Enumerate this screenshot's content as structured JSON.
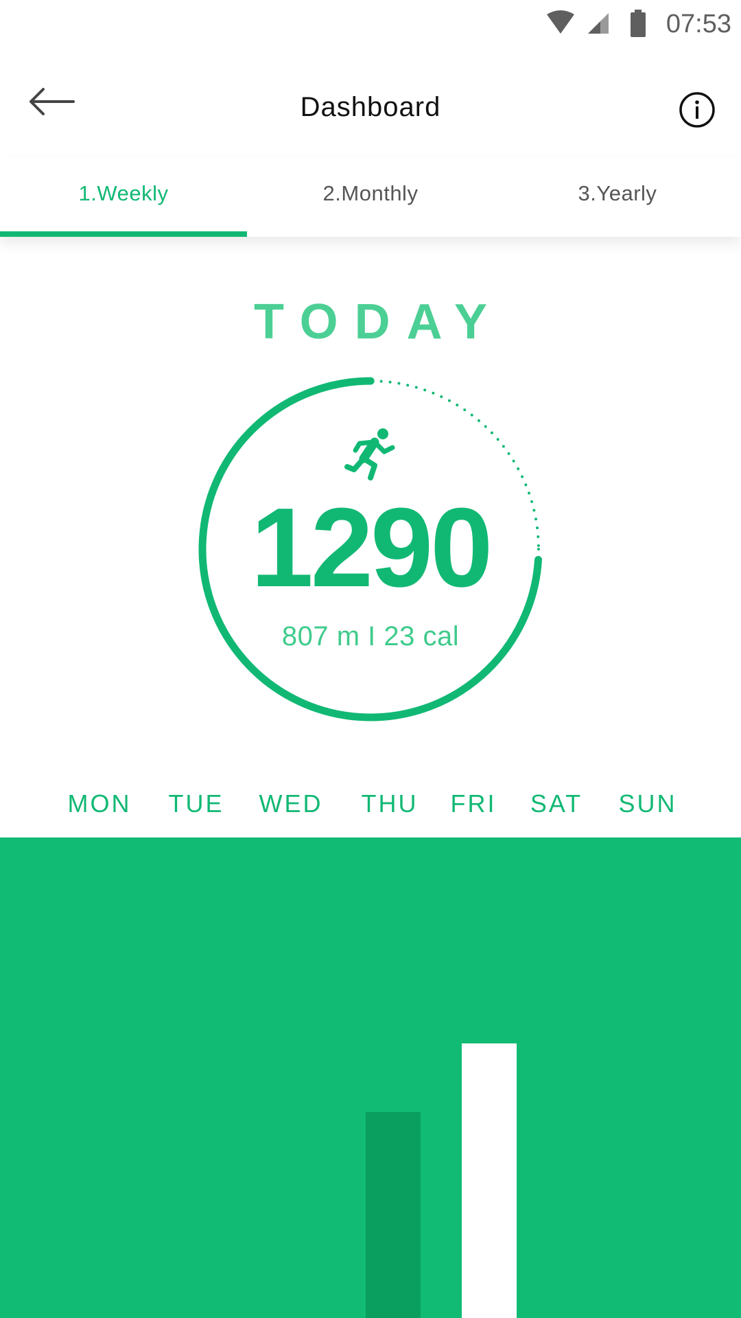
{
  "status_bar": {
    "time": "07:53",
    "icons": [
      "wifi-icon",
      "cell-signal-icon",
      "battery-icon"
    ]
  },
  "header": {
    "title": "Dashboard",
    "back_icon": "arrow-left-icon",
    "info_icon": "info-icon"
  },
  "tabs": [
    {
      "label": "1.Weekly",
      "active": true
    },
    {
      "label": "2.Monthly",
      "active": false
    },
    {
      "label": "3.Yearly",
      "active": false
    }
  ],
  "today": {
    "heading": "TODAY",
    "icon": "running-person-icon",
    "steps": "1290",
    "summary": "807 m I 23 cal",
    "goal_progress": 0.74
  },
  "week": {
    "days": [
      "MON",
      "TUE",
      "WED",
      "THU",
      "FRI",
      "SAT",
      "SUN"
    ]
  },
  "chart_data": {
    "type": "bar",
    "categories": [
      "MON",
      "TUE",
      "WED",
      "THU",
      "FRI",
      "SAT",
      "SUN"
    ],
    "values": [
      0,
      0,
      0,
      300,
      400,
      0,
      0
    ],
    "ylim": [
      0,
      700
    ],
    "highlight": "FRI",
    "colors": {
      "background": "#11bb74",
      "bar": "#0a9f5f",
      "highlight": "#ffffff"
    }
  },
  "colors": {
    "accent": "#11b874",
    "accent_light": "#4ccf94",
    "text": "#111111"
  }
}
